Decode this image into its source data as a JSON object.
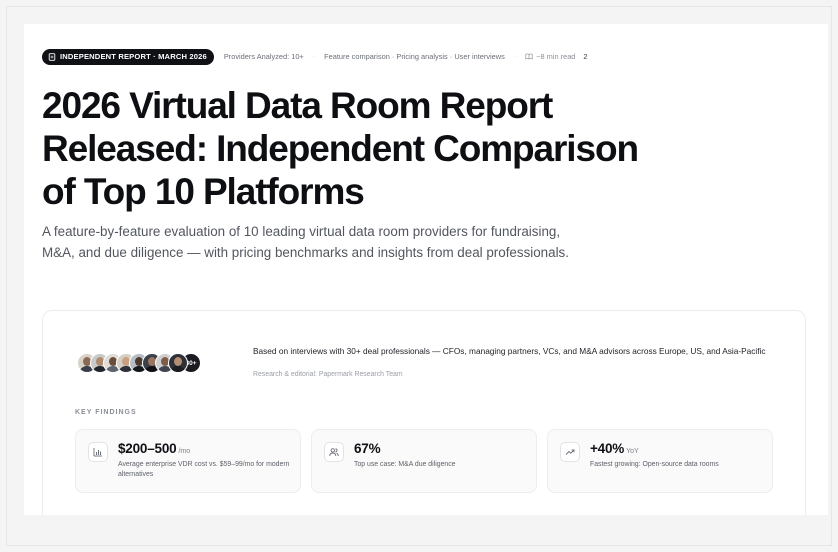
{
  "meta": {
    "badge_icon": "document-icon",
    "badge": "INDEPENDENT REPORT · MARCH 2026",
    "providers": "Providers Analyzed: 10+",
    "methods": "Feature comparison · Pricing analysis · User interviews",
    "read_icon": "book-icon",
    "read_time": "~8 min read",
    "count": "2"
  },
  "title": "2026 Virtual Data Room Report Released: Independent Comparison of Top 10 Platforms",
  "subtitle": "A feature-by-feature evaluation of 10 leading virtual data room providers for fundraising, M&A, and due diligence — with pricing benchmarks and insights from deal professionals.",
  "card": {
    "avatars_more": "30+",
    "interview_text": "Based on interviews with 30+ deal professionals — CFOs, managing partners, VCs, and M&A advisors across Europe, US, and Asia-Pacific",
    "editorial": "Research & editorial: Papermark Research Team",
    "key_findings_label": "KEY FINDINGS",
    "findings": [
      {
        "icon": "bar-chart-icon",
        "value": "$200–500",
        "unit": "/mo",
        "desc": "Average enterprise VDR cost vs. $59–99/mo for modern alternatives"
      },
      {
        "icon": "users-icon",
        "value": "67%",
        "unit": "",
        "desc": "Top use case: M&A due diligence"
      },
      {
        "icon": "trending-up-icon",
        "value": "+40%",
        "unit": "YoY",
        "desc": "Fastest growing: Open-source data rooms"
      }
    ]
  }
}
